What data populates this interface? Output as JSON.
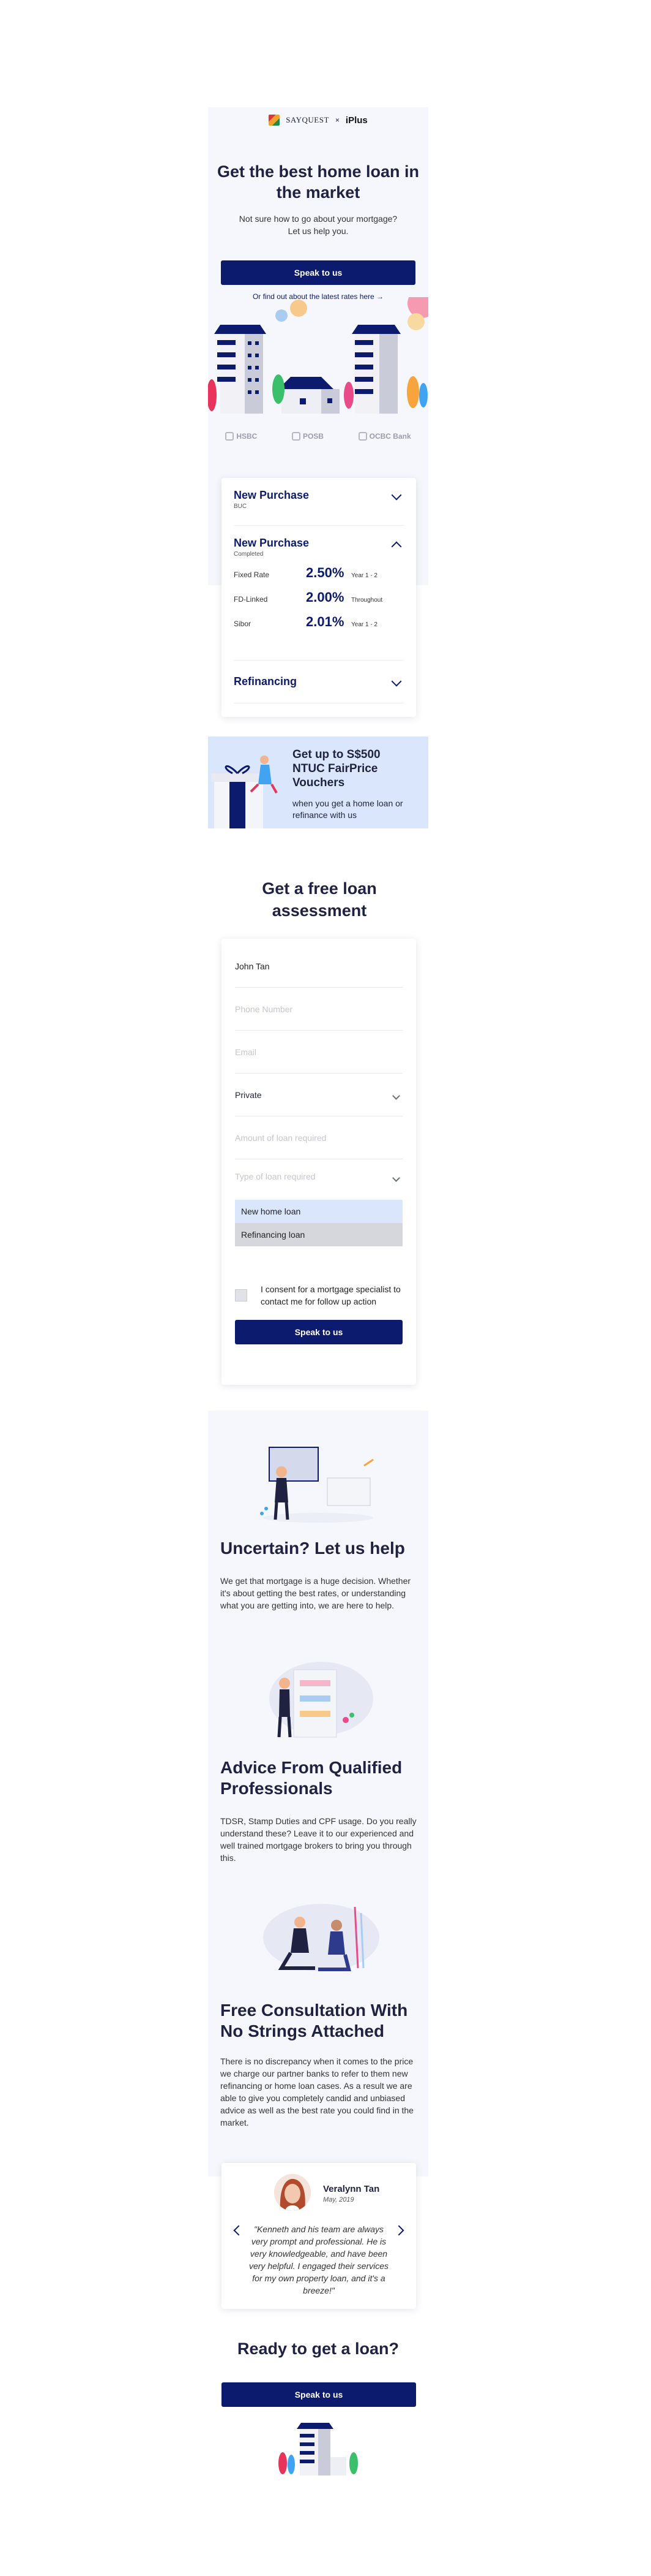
{
  "header": {
    "brand_left": "SAYQUEST",
    "separator": "×",
    "brand_right": "iPlus"
  },
  "hero": {
    "title": "Get the best home loan in the market",
    "subtitle": "Not sure how to go about your mortgage? Let us help you.",
    "cta_label": "Speak to us",
    "rates_link": "Or find out about the latest rates here →",
    "banks": [
      "HSBC",
      "POSB",
      "OCBC Bank"
    ]
  },
  "rates": {
    "sections": [
      {
        "title": "New Purchase",
        "subtitle": "BUC"
      },
      {
        "title": "New Purchase",
        "subtitle": "Completed"
      },
      {
        "title": "Refinancing",
        "subtitle": ""
      }
    ],
    "rows": [
      {
        "label": "Fixed Rate",
        "value": "2.50%",
        "note": "Year 1 - 2"
      },
      {
        "label": "FD-Linked",
        "value": "2.00%",
        "note": "Throughout"
      },
      {
        "label": "Sibor",
        "value": "2.01%",
        "note": "Year 1 - 2"
      }
    ]
  },
  "promo": {
    "title": "Get up to S$500 NTUC FairPrice Vouchers",
    "subtitle": "when you get a home loan or refinance with us"
  },
  "assessment": {
    "title": "Get a free loan assessment",
    "name_value": "John Tan",
    "phone_placeholder": "Phone Number",
    "email_placeholder": "Email",
    "property_value": "Private",
    "amount_placeholder": "Amount of loan required",
    "type_placeholder": "Type of loan required",
    "type_options": [
      "New home loan",
      "Refinancing loan"
    ],
    "consent": "I consent for a mortgage specialist to contact me for follow up action",
    "submit_label": "Speak to us"
  },
  "features": [
    {
      "title": "Uncertain? Let us help",
      "body": "We get that mortgage is a huge decision. Whether it's about getting the best rates, or understanding what you are getting into, we are here to help."
    },
    {
      "title": "Advice From Qualified Professionals",
      "body": "TDSR, Stamp Duties and CPF usage. Do you really understand these? Leave it to our experienced and well trained mortgage brokers to bring you through this."
    },
    {
      "title": "Free Consultation With No Strings Attached",
      "body": "There is no discrepancy when it comes to the price we charge our partner banks to refer to them new refinancing or home loan cases. As a result we are able to give you completely candid and unbiased advice as well as the best rate you could find in the market."
    }
  ],
  "testimonial": {
    "name": "Veralynn Tan",
    "date": "May, 2019",
    "quote": "\"Kenneth and his team are always very prompt and professional. He is very knowledgeable, and have been very helpful. I engaged their services for my own property loan, and it's a breeze!\""
  },
  "cta": {
    "title": "Ready to get a loan?",
    "button_label": "Speak to us"
  },
  "colors": {
    "navy": "#0d1b6e",
    "hero_bg": "#f6f7fc",
    "promo_bg": "#d9e6fc",
    "option_selected": "#d9e6fc",
    "option_other": "#d6d7dc"
  }
}
